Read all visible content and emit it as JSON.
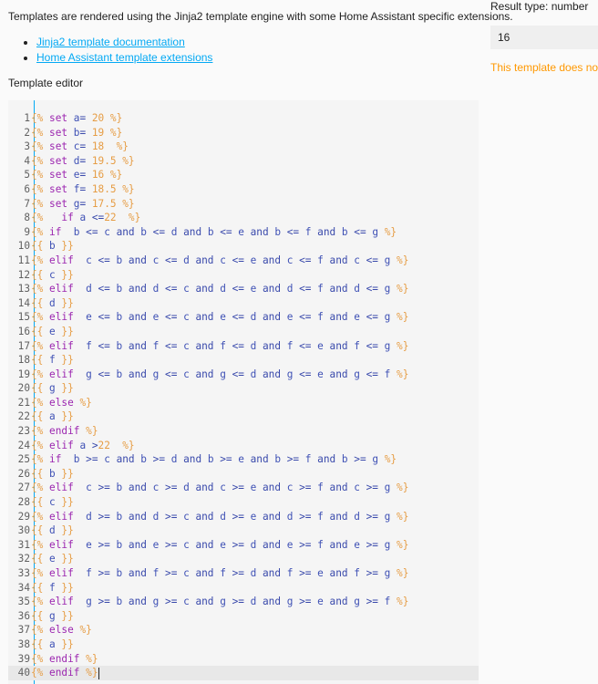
{
  "intro": "Templates are rendered using the Jinja2 template engine with some Home Assistant specific extensions.",
  "links": [
    "Jinja2 template documentation",
    "Home Assistant template extensions"
  ],
  "editor_label": "Template editor",
  "result": {
    "type_label": "Result type: number",
    "value": "16",
    "warning": "This template does not l"
  },
  "colors": {
    "link": "#03a9f4",
    "warning": "#ff9800",
    "delimiter": "#e69d45",
    "keyword": "#9c27b0",
    "operator": "#3949ab",
    "variable": "#3f51b5"
  },
  "code_lines": [
    "{% set a= 20 %}",
    "{% set b= 19 %}",
    "{% set c= 18  %}",
    "{% set d= 19.5 %}",
    "{% set e= 16 %}",
    "{% set f= 18.5 %}",
    "{% set g= 17.5 %}",
    "{%   if a <=22  %}",
    "{% if  b <= c and b <= d and b <= e and b <= f and b <= g %}",
    "{{ b }}",
    "{% elif  c <= b and c <= d and c <= e and c <= f and c <= g %}",
    "{{ c }}",
    "{% elif  d <= b and d <= c and d <= e and d <= f and d <= g %}",
    "{{ d }}",
    "{% elif  e <= b and e <= c and e <= d and e <= f and e <= g %}",
    "{{ e }}",
    "{% elif  f <= b and f <= c and f <= d and f <= e and f <= g %}",
    "{{ f }}",
    "{% elif  g <= b and g <= c and g <= d and g <= e and g <= f %}",
    "{{ g }}",
    "{% else %}",
    "{{ a }}",
    "{% endif %}",
    "{% elif a >22  %}",
    "{% if  b >= c and b >= d and b >= e and b >= f and b >= g %}",
    "{{ b }}",
    "{% elif  c >= b and c >= d and c >= e and c >= f and c >= g %}",
    "{{ c }}",
    "{% elif  d >= b and d >= c and d >= e and d >= f and d >= g %}",
    "{{ d }}",
    "{% elif  e >= b and e >= c and e >= d and e >= f and e >= g %}",
    "{{ e }}",
    "{% elif  f >= b and f >= c and f >= d and f >= e and f >= g %}",
    "{{ f }}",
    "{% elif  g >= b and g >= c and g >= d and g >= e and g >= f %}",
    "{{ g }}",
    "{% else %}",
    "{{ a }}",
    "{% endif %}",
    "{% endif %}"
  ]
}
